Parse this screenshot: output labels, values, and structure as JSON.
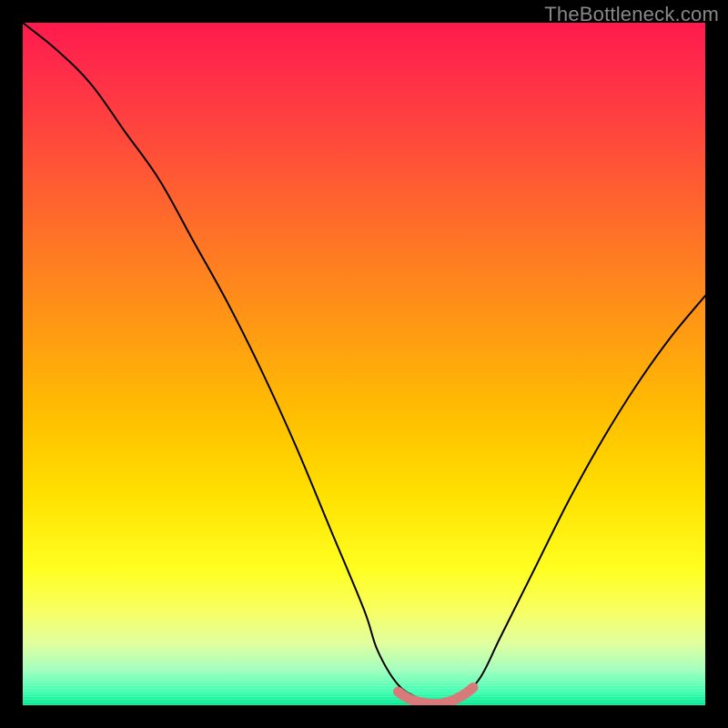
{
  "watermark": {
    "text": "TheBottleneck.com"
  },
  "chart_data": {
    "type": "line",
    "title": "",
    "xlabel": "",
    "ylabel": "",
    "xlim": [
      0,
      100
    ],
    "ylim": [
      0,
      100
    ],
    "series": [
      {
        "name": "bottleneck-curve",
        "x": [
          0,
          5,
          10,
          15,
          20,
          25,
          30,
          35,
          40,
          45,
          50,
          52,
          55,
          58,
          60,
          62,
          64,
          67,
          70,
          75,
          80,
          85,
          90,
          95,
          100
        ],
        "values": [
          100,
          96,
          91,
          84,
          77,
          68,
          59,
          49,
          38,
          26,
          14,
          8,
          3,
          1,
          0,
          0,
          1,
          4,
          10,
          20,
          30,
          39,
          47,
          54,
          60
        ]
      },
      {
        "name": "optimal-zone-highlight",
        "x": [
          55,
          56,
          57,
          58,
          59,
          60,
          61,
          62,
          63,
          64,
          65,
          66
        ],
        "values": [
          2.0,
          1.3,
          0.8,
          0.5,
          0.3,
          0.2,
          0.2,
          0.4,
          0.7,
          1.2,
          1.8,
          2.6
        ]
      }
    ],
    "colors": {
      "curve_stroke": "#000000",
      "highlight_stroke": "#d97a7a",
      "gradient_top": "#ff1a4d",
      "gradient_mid": "#ffe000",
      "gradient_bottom": "#00e890"
    }
  }
}
